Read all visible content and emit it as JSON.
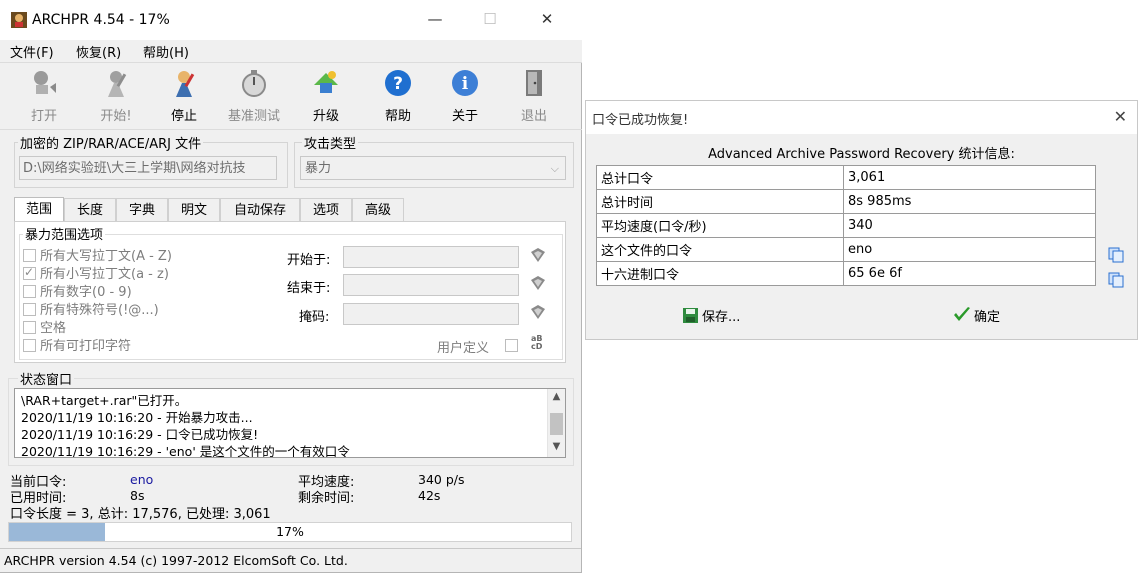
{
  "window": {
    "title": "ARCHPR 4.54 - 17%",
    "controls": {
      "minimize": "—",
      "maximize": "☐",
      "close": "✕"
    }
  },
  "menu": [
    "文件(F)",
    "恢复(R)",
    "帮助(H)"
  ],
  "toolbar": {
    "open": "打开",
    "start": "开始!",
    "stop": "停止",
    "benchmark": "基准测试",
    "upgrade": "升级",
    "help": "帮助",
    "about": "关于",
    "exit": "退出"
  },
  "encrypted_file": {
    "label": "加密的 ZIP/RAR/ACE/ARJ 文件",
    "value": "D:\\网络实验班\\大三上学期\\网络对抗技"
  },
  "attack": {
    "label": "攻击类型",
    "value": "暴力"
  },
  "tabs": [
    "范围",
    "长度",
    "字典",
    "明文",
    "自动保存",
    "选项",
    "高级"
  ],
  "brute_force": {
    "group_label": "暴力范围选项",
    "options": [
      {
        "label": "所有大写拉丁文(A - Z)",
        "checked": false
      },
      {
        "label": "所有小写拉丁文(a - z)",
        "checked": true
      },
      {
        "label": "所有数字(0 - 9)",
        "checked": false
      },
      {
        "label": "所有特殊符号(!@...)",
        "checked": false
      },
      {
        "label": "空格",
        "checked": false
      },
      {
        "label": "所有可打印字符",
        "checked": false
      }
    ],
    "start_from": "开始于:",
    "end_at": "结束于:",
    "mask": "掩码:",
    "user_defined": "用户定义"
  },
  "status": {
    "label": "状态窗口",
    "log": [
      "\\RAR+target+.rar\"已打开。",
      "2020/11/19 10:16:20 - 开始暴力攻击...",
      "2020/11/19 10:16:29 - 口令已成功恢复!",
      "2020/11/19 10:16:29 - 'eno' 是这个文件的一个有效口令"
    ]
  },
  "stats": {
    "current_password_label": "当前口令:",
    "current_password": "eno",
    "elapsed_label": "已用时间:",
    "elapsed": "8s",
    "avg_speed_label": "平均速度:",
    "avg_speed": "340 p/s",
    "remaining_label": "剩余时间:",
    "remaining": "42s",
    "summary": "口令长度 = 3, 总计: 17,576, 已处理: 3,061"
  },
  "progress": {
    "text": "17%",
    "value": 0.17
  },
  "statusbar": "ARCHPR version 4.54 (c) 1997-2012 ElcomSoft Co. Ltd.",
  "dialog": {
    "title": "口令已成功恢复!",
    "close": "✕",
    "heading": "Advanced Archive Password Recovery 统计信息:",
    "rows": [
      {
        "key": "总计口令",
        "value": "3,061"
      },
      {
        "key": "总计时间",
        "value": "8s 985ms"
      },
      {
        "key": "平均速度(口令/秒)",
        "value": "340"
      },
      {
        "key": "这个文件的口令",
        "value": "eno"
      },
      {
        "key": "十六进制口令",
        "value": "65 6e 6f"
      }
    ],
    "save_label": "保存...",
    "ok_label": "确定"
  },
  "colors": {
    "window_bg": "#f0f0f0",
    "value_blue": "#1a1aa0",
    "progress_fill": "#9ab8d8",
    "ok_green": "#2a9a2a"
  }
}
